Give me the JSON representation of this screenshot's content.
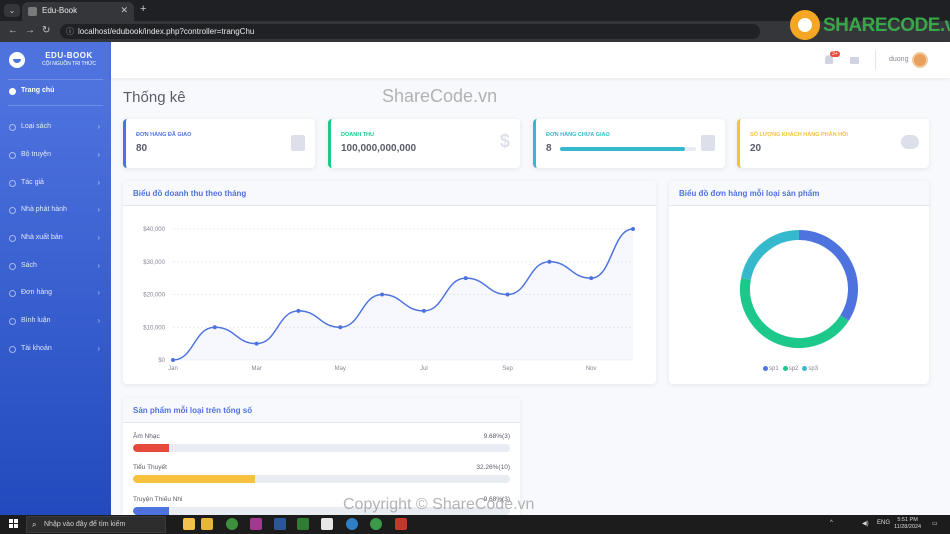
{
  "browser": {
    "tab_title": "Edu-Book",
    "url": "localhost/edubook/index.php?controller=trangChu"
  },
  "watermark": {
    "brand": "SHARECODE.vn",
    "top": "ShareCode.vn",
    "bottom": "Copyright © ShareCode.vn"
  },
  "sidebar": {
    "title": "EDU-BOOK",
    "subtitle": "CỘI NGUỒN TRI THỨC",
    "items": [
      {
        "label": "Trang chủ",
        "active": true
      },
      {
        "label": "Loại sách"
      },
      {
        "label": "Bộ truyện"
      },
      {
        "label": "Tác giả"
      },
      {
        "label": "Nhà phát hành"
      },
      {
        "label": "Nhà xuất bản"
      },
      {
        "label": "Sách"
      },
      {
        "label": "Đơn hàng"
      },
      {
        "label": "Bình luận"
      },
      {
        "label": "Tài khoản"
      }
    ]
  },
  "topbar": {
    "badge": "3+",
    "username": "duong"
  },
  "page_title": "Thống kê",
  "stats": [
    {
      "label": "ĐƠN HÀNG ĐÃ GIAO",
      "value": "80",
      "color": "#4e73df",
      "icon": "calendar-icon"
    },
    {
      "label": "DOANH THU",
      "value": "100,000,000,000",
      "color": "#1cc88a",
      "icon": "dollar-icon"
    },
    {
      "label": "ĐƠN HÀNG CHƯA GIAO",
      "value": "8",
      "color": "#36b9cc",
      "icon": "clipboard-icon",
      "progress": 0.92
    },
    {
      "label": "SỐ LƯỢNG KHÁCH HÀNG PHẢN HỒI",
      "value": "20",
      "color": "#f6c23e",
      "icon": "comments-icon"
    }
  ],
  "charts": {
    "area_title": "Biểu đồ doanh thu theo tháng",
    "donut_title": "Biểu đồ đơn hàng mỗi loại sản phẩm"
  },
  "chart_data": [
    {
      "type": "area",
      "title": "Biểu đồ doanh thu theo tháng",
      "x": [
        "Jan",
        "Feb",
        "Mar",
        "Apr",
        "May",
        "Jun",
        "Jul",
        "Aug",
        "Sep",
        "Oct",
        "Nov",
        "Dec"
      ],
      "x_tick_labels": [
        "Jan",
        "Mar",
        "May",
        "Jul",
        "Sep",
        "Nov"
      ],
      "values": [
        0,
        10000,
        5000,
        15000,
        10000,
        20000,
        15000,
        25000,
        20000,
        30000,
        25000,
        40000
      ],
      "y_ticks": [
        "$0",
        "$10,000",
        "$20,000",
        "$30,000",
        "$40,000"
      ],
      "ylim": [
        0,
        40000
      ],
      "color": "#4e73df",
      "grid": true
    },
    {
      "type": "pie",
      "title": "Biểu đồ đơn hàng mỗi loại sản phẩm",
      "categories": [
        "sp1",
        "sp2",
        "sp3"
      ],
      "values": [
        34,
        44,
        22
      ],
      "colors": [
        "#4e73df",
        "#1cc88a",
        "#36b9cc"
      ],
      "legend": "bottom"
    }
  ],
  "progress_card": {
    "title": "Sản phẩm mỗi loại trên tổng số",
    "rows": [
      {
        "label": "Âm Nhạc",
        "value": "9.68%(3)",
        "pct": 9.68,
        "color": "#e74a3b"
      },
      {
        "label": "Tiểu Thuyết",
        "value": "32.26%(10)",
        "pct": 32.26,
        "color": "#f6c23e"
      },
      {
        "label": "Truyện Thiếu Nhi",
        "value": "9.68%(3)",
        "pct": 9.68,
        "color": "#4e73df"
      }
    ]
  },
  "taskbar": {
    "search_placeholder": "Nhập vào đây để tìm kiếm",
    "lang": "ENG",
    "time": "5:51 PM",
    "date": "11/28/2024"
  }
}
